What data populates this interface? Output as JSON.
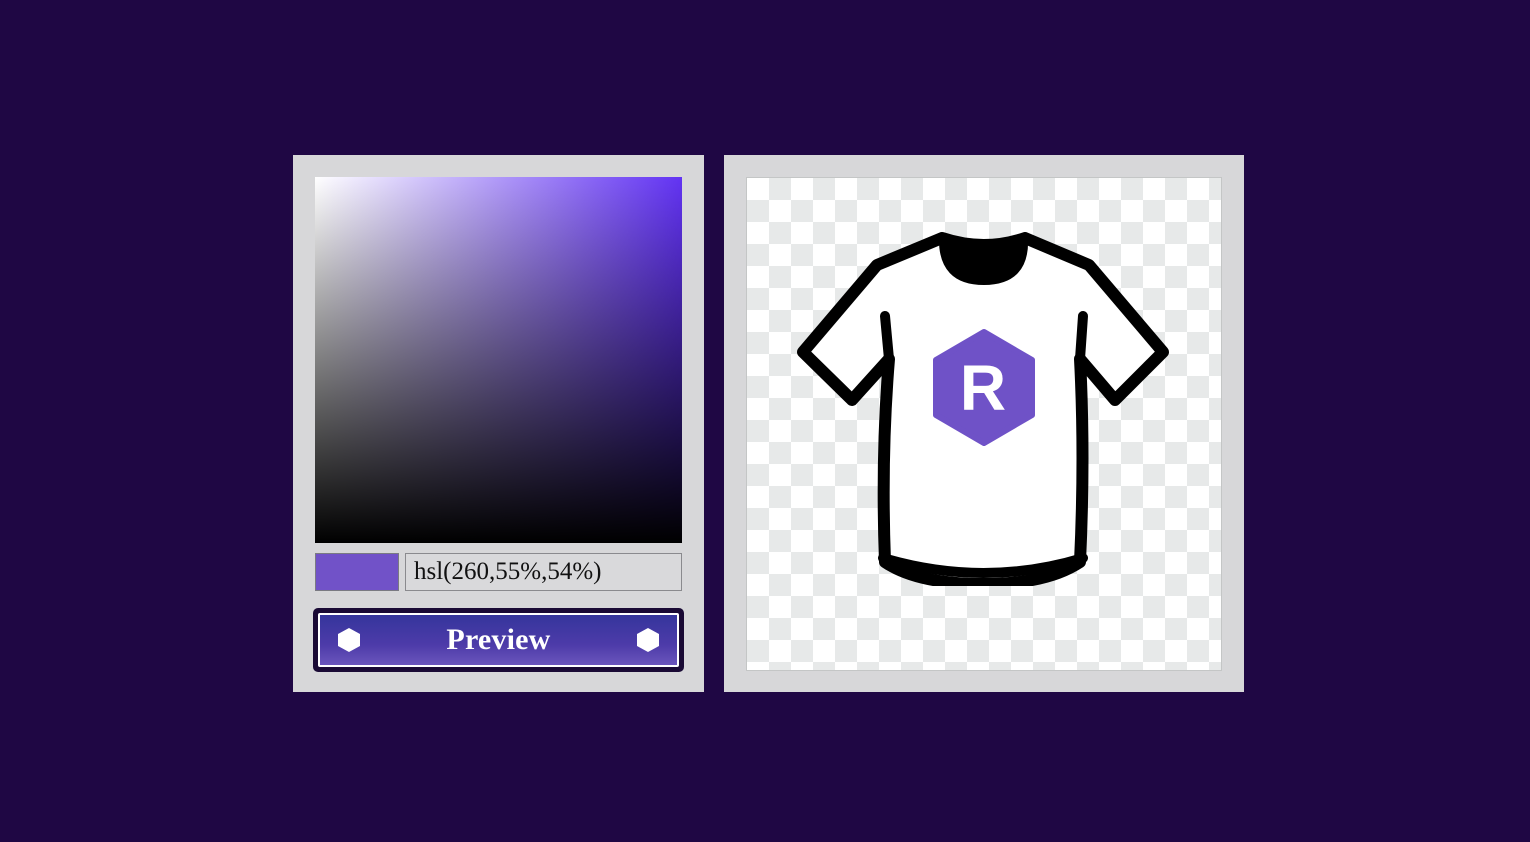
{
  "picker": {
    "gradient_hue_color": "#6233f3",
    "selected_color_hex": "#7152c8",
    "hsl_value": "hsl(260,55%,54%)"
  },
  "preview_button": {
    "label": "Preview",
    "icon": "hexagon-icon"
  },
  "preview": {
    "product": "t-shirt",
    "logo_letter": "R",
    "logo_color": "#6f52c7"
  }
}
